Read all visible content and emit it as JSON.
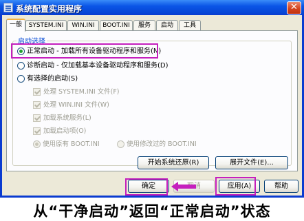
{
  "window": {
    "title": "系统配置实用程序",
    "close_glyph": "✕"
  },
  "tabs": [
    {
      "label": "一般",
      "active": true
    },
    {
      "label": "SYSTEM.INI"
    },
    {
      "label": "WIN.INI"
    },
    {
      "label": "BOOT.INI"
    },
    {
      "label": "服务"
    },
    {
      "label": "启动"
    },
    {
      "label": "工具"
    }
  ],
  "startup_group": {
    "legend": "启动选择",
    "options": [
      {
        "label": "正常启动 - 加载所有设备驱动程序和服务(N)",
        "checked": true
      },
      {
        "label": "诊断启动 - 仅加载基本设备驱动程序和服务(D)",
        "checked": false
      },
      {
        "label": "有选择的启动(S)",
        "checked": false
      }
    ],
    "selective_items": [
      "处理 SYSTEM.INI 文件(F)",
      "处理 WIN.INI 文件(W)",
      "加载系统服务(L)",
      "加载启动项(O)"
    ],
    "boot_options": [
      {
        "label": "使用原有 BOOT.INI",
        "checked": true
      },
      {
        "label": "使用修改过的 BOOT.INI",
        "checked": false
      }
    ]
  },
  "buttons": {
    "restore": "开始系统还原(R)",
    "expand": "展开文件(E)...",
    "ok": "确定",
    "cancel": "取消",
    "apply": "应用(A)",
    "help": "帮助"
  },
  "caption": "从“干净启动”返回“正常启动”状态",
  "colors": {
    "highlight": "#c51fbd",
    "title_bar": "#0b55e6",
    "arrow": "#c51fbd"
  }
}
